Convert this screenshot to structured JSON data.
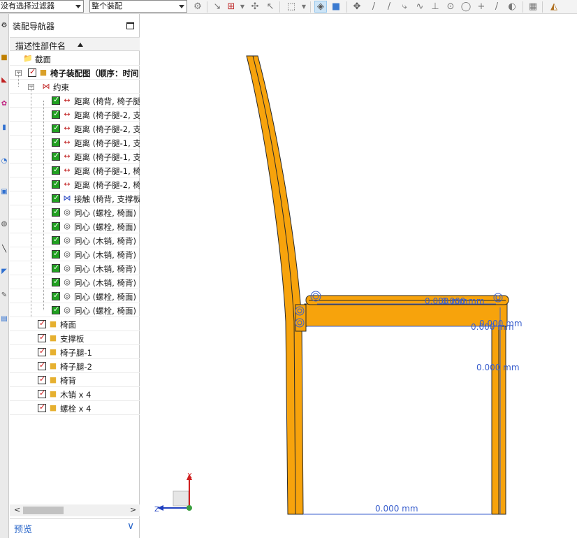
{
  "toolbar": {
    "filter_value": "没有选择过滤器",
    "scope_value": "整个装配"
  },
  "navigator": {
    "title": "装配导航器",
    "column_header": "描述性部件名",
    "rows": [
      {
        "label": "截面",
        "icon": "folder-icon",
        "check": "none"
      },
      {
        "label": "椅子装配图（顺序：时间",
        "icon": "assembly-icon",
        "check": "red"
      },
      {
        "label": "约束",
        "icon": "constraints-icon",
        "check": "none"
      },
      {
        "label": "距离 (椅背, 椅子腿",
        "icon": "distance-constraint-icon",
        "check": "green"
      },
      {
        "label": "距离 (椅子腿-2, 支",
        "icon": "distance-constraint-icon",
        "check": "green"
      },
      {
        "label": "距离 (椅子腿-2, 支",
        "icon": "distance-constraint-icon",
        "check": "green"
      },
      {
        "label": "距离 (椅子腿-1, 支",
        "icon": "distance-constraint-icon",
        "check": "green"
      },
      {
        "label": "距离 (椅子腿-1, 支",
        "icon": "distance-constraint-icon",
        "check": "green"
      },
      {
        "label": "距离 (椅子腿-1, 椅",
        "icon": "distance-constraint-icon",
        "check": "green"
      },
      {
        "label": "距离 (椅子腿-2, 椅",
        "icon": "distance-constraint-icon",
        "check": "green"
      },
      {
        "label": "接触 (椅背, 支撑板",
        "icon": "touch-constraint-icon",
        "check": "green"
      },
      {
        "label": "同心 (螺栓, 椅面)",
        "icon": "concentric-constraint-icon",
        "check": "green"
      },
      {
        "label": "同心 (螺栓, 椅面)",
        "icon": "concentric-constraint-icon",
        "check": "green"
      },
      {
        "label": "同心 (木销, 椅背)",
        "icon": "concentric-constraint-icon",
        "check": "green"
      },
      {
        "label": "同心 (木销, 椅背)",
        "icon": "concentric-constraint-icon",
        "check": "green"
      },
      {
        "label": "同心 (木销, 椅背)",
        "icon": "concentric-constraint-icon",
        "check": "green"
      },
      {
        "label": "同心 (木销, 椅背)",
        "icon": "concentric-constraint-icon",
        "check": "green"
      },
      {
        "label": "同心 (螺栓, 椅面)",
        "icon": "concentric-constraint-icon",
        "check": "green"
      },
      {
        "label": "同心 (螺栓, 椅面)",
        "icon": "concentric-constraint-icon",
        "check": "green"
      },
      {
        "label": "椅面",
        "icon": "component-icon",
        "check": "red"
      },
      {
        "label": "支撑板",
        "icon": "component-icon",
        "check": "red"
      },
      {
        "label": "椅子腿-1",
        "icon": "component-icon",
        "check": "red"
      },
      {
        "label": "椅子腿-2",
        "icon": "component-icon",
        "check": "red"
      },
      {
        "label": "椅背",
        "icon": "component-icon",
        "check": "red"
      },
      {
        "label": "木销 x 4",
        "icon": "component-icon",
        "check": "red"
      },
      {
        "label": "螺栓 x 4",
        "icon": "component-icon",
        "check": "red"
      }
    ],
    "preview_label": "预览"
  },
  "viewport": {
    "dimensions": [
      "0.000 mm",
      "0.000 mm",
      "0.000 mm",
      "0.000 mm",
      "0.000 mm",
      "0.000 mm"
    ],
    "triad": {
      "x_label": "X",
      "z_label": "Z"
    },
    "colors": {
      "wood": "#f7a30c",
      "wood_edge": "#2a2a2a",
      "dimension": "#3a5fcd",
      "triad_x": "#d02020",
      "triad_z": "#2040c0"
    }
  }
}
